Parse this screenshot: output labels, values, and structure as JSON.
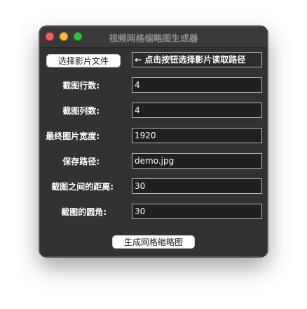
{
  "window": {
    "title": "视频网格缩略图生成器"
  },
  "form": {
    "select_button_label": "选择影片文件",
    "path_hint": "← 点击按钮选择影片读取路径",
    "rows_label": "截图行数:",
    "rows_value": "4",
    "cols_label": "截图列数:",
    "cols_value": "4",
    "width_label": "最终图片宽度:",
    "width_value": "1920",
    "save_path_label": "保存路径:",
    "save_path_value": "demo.jpg",
    "spacing_label": "截图之间的距离:",
    "spacing_value": "30",
    "radius_label": "截图的圆角:",
    "radius_value": "30",
    "generate_button_label": "生成网格缩略图"
  },
  "colors": {
    "window_bg": "#323232",
    "close": "#ff5f57",
    "minimize": "#febc2e",
    "maximize": "#28c840"
  }
}
